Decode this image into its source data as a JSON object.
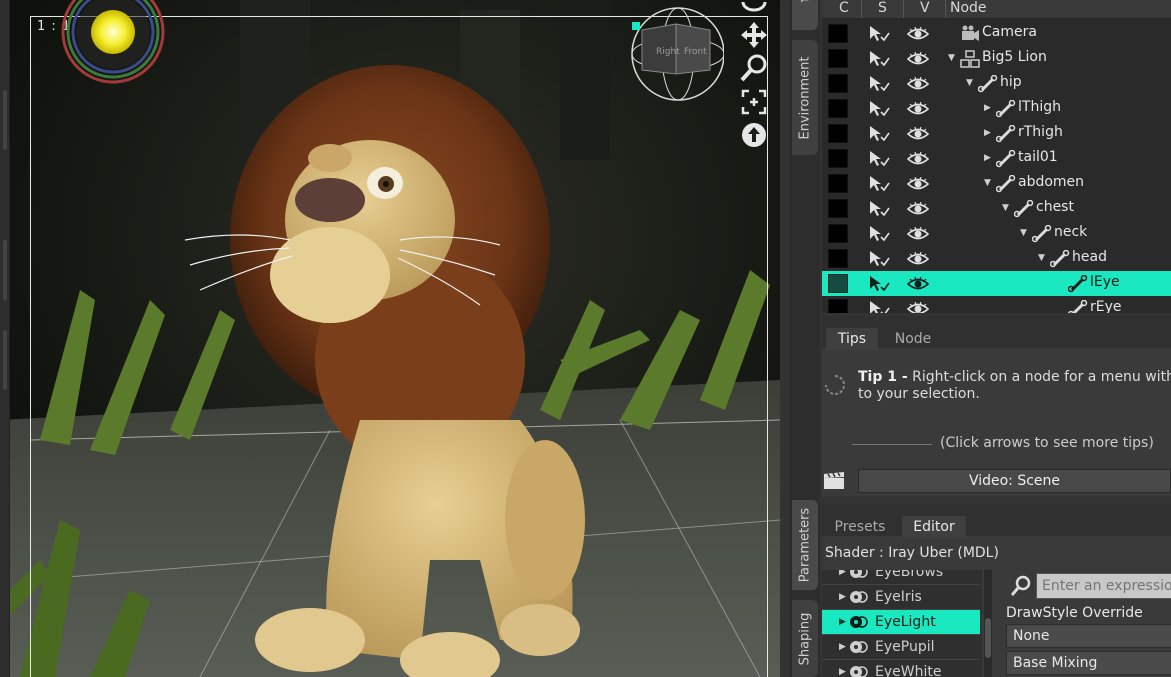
{
  "viewport": {
    "aspect_label": "1 : 1",
    "cube_faces": [
      "Right",
      "Front"
    ]
  },
  "side_tabs": {
    "scene": "Scene",
    "environment": "Environment",
    "parameters": "Parameters",
    "shaping": "Shaping"
  },
  "scene_tree": {
    "columns": [
      "C",
      "S",
      "V",
      "Node"
    ],
    "nodes": [
      {
        "label": "Camera",
        "icon": "camera-icon",
        "arrow": "",
        "selected": false
      },
      {
        "label": "Big5 Lion",
        "icon": "figure-icon",
        "arrow": "▼",
        "selected": false
      },
      {
        "label": "hip",
        "icon": "bone-icon",
        "arrow": "▼",
        "selected": false
      },
      {
        "label": "lThigh",
        "icon": "bone-icon",
        "arrow": "▶",
        "selected": false
      },
      {
        "label": "rThigh",
        "icon": "bone-icon",
        "arrow": "▶",
        "selected": false
      },
      {
        "label": "tail01",
        "icon": "bone-icon",
        "arrow": "▶",
        "selected": false
      },
      {
        "label": "abdomen",
        "icon": "bone-icon",
        "arrow": "▼",
        "selected": false
      },
      {
        "label": "chest",
        "icon": "bone-icon",
        "arrow": "▼",
        "selected": false
      },
      {
        "label": "neck",
        "icon": "bone-icon",
        "arrow": "▼",
        "selected": false
      },
      {
        "label": "head",
        "icon": "bone-icon",
        "arrow": "▼",
        "selected": false
      },
      {
        "label": "lEye",
        "icon": "bone-icon",
        "arrow": "",
        "selected": true
      },
      {
        "label": "rEye",
        "icon": "bone-icon",
        "arrow": "",
        "selected": false
      }
    ]
  },
  "tips": {
    "tabs": [
      "Tips",
      "Node"
    ],
    "tip_title": "Tip 1 -",
    "tip_body_1": "Right-click on a node for a menu with op",
    "tip_body_2": "to your selection.",
    "nav_text": "(Click arrows to see more tips)",
    "video_button": "Video: Scene"
  },
  "surfaces": {
    "tabs": [
      "Presets",
      "Editor"
    ],
    "shader_label": "Shader :  Iray Uber (MDL)",
    "items": [
      {
        "label": "EyeBrows",
        "selected": false
      },
      {
        "label": "EyeIris",
        "selected": false
      },
      {
        "label": "EyeLight",
        "selected": true
      },
      {
        "label": "EyePupil",
        "selected": false
      },
      {
        "label": "EyeWhite",
        "selected": false
      }
    ],
    "search_placeholder": "Enter an expression t",
    "drawstyle_label": "DrawStyle Override",
    "drawstyle_value": "None",
    "base_mixing_label": "Base Mixing"
  },
  "colors": {
    "selection": "#19e8c0",
    "panel": "#333333",
    "frame": "#e8e8e8"
  }
}
